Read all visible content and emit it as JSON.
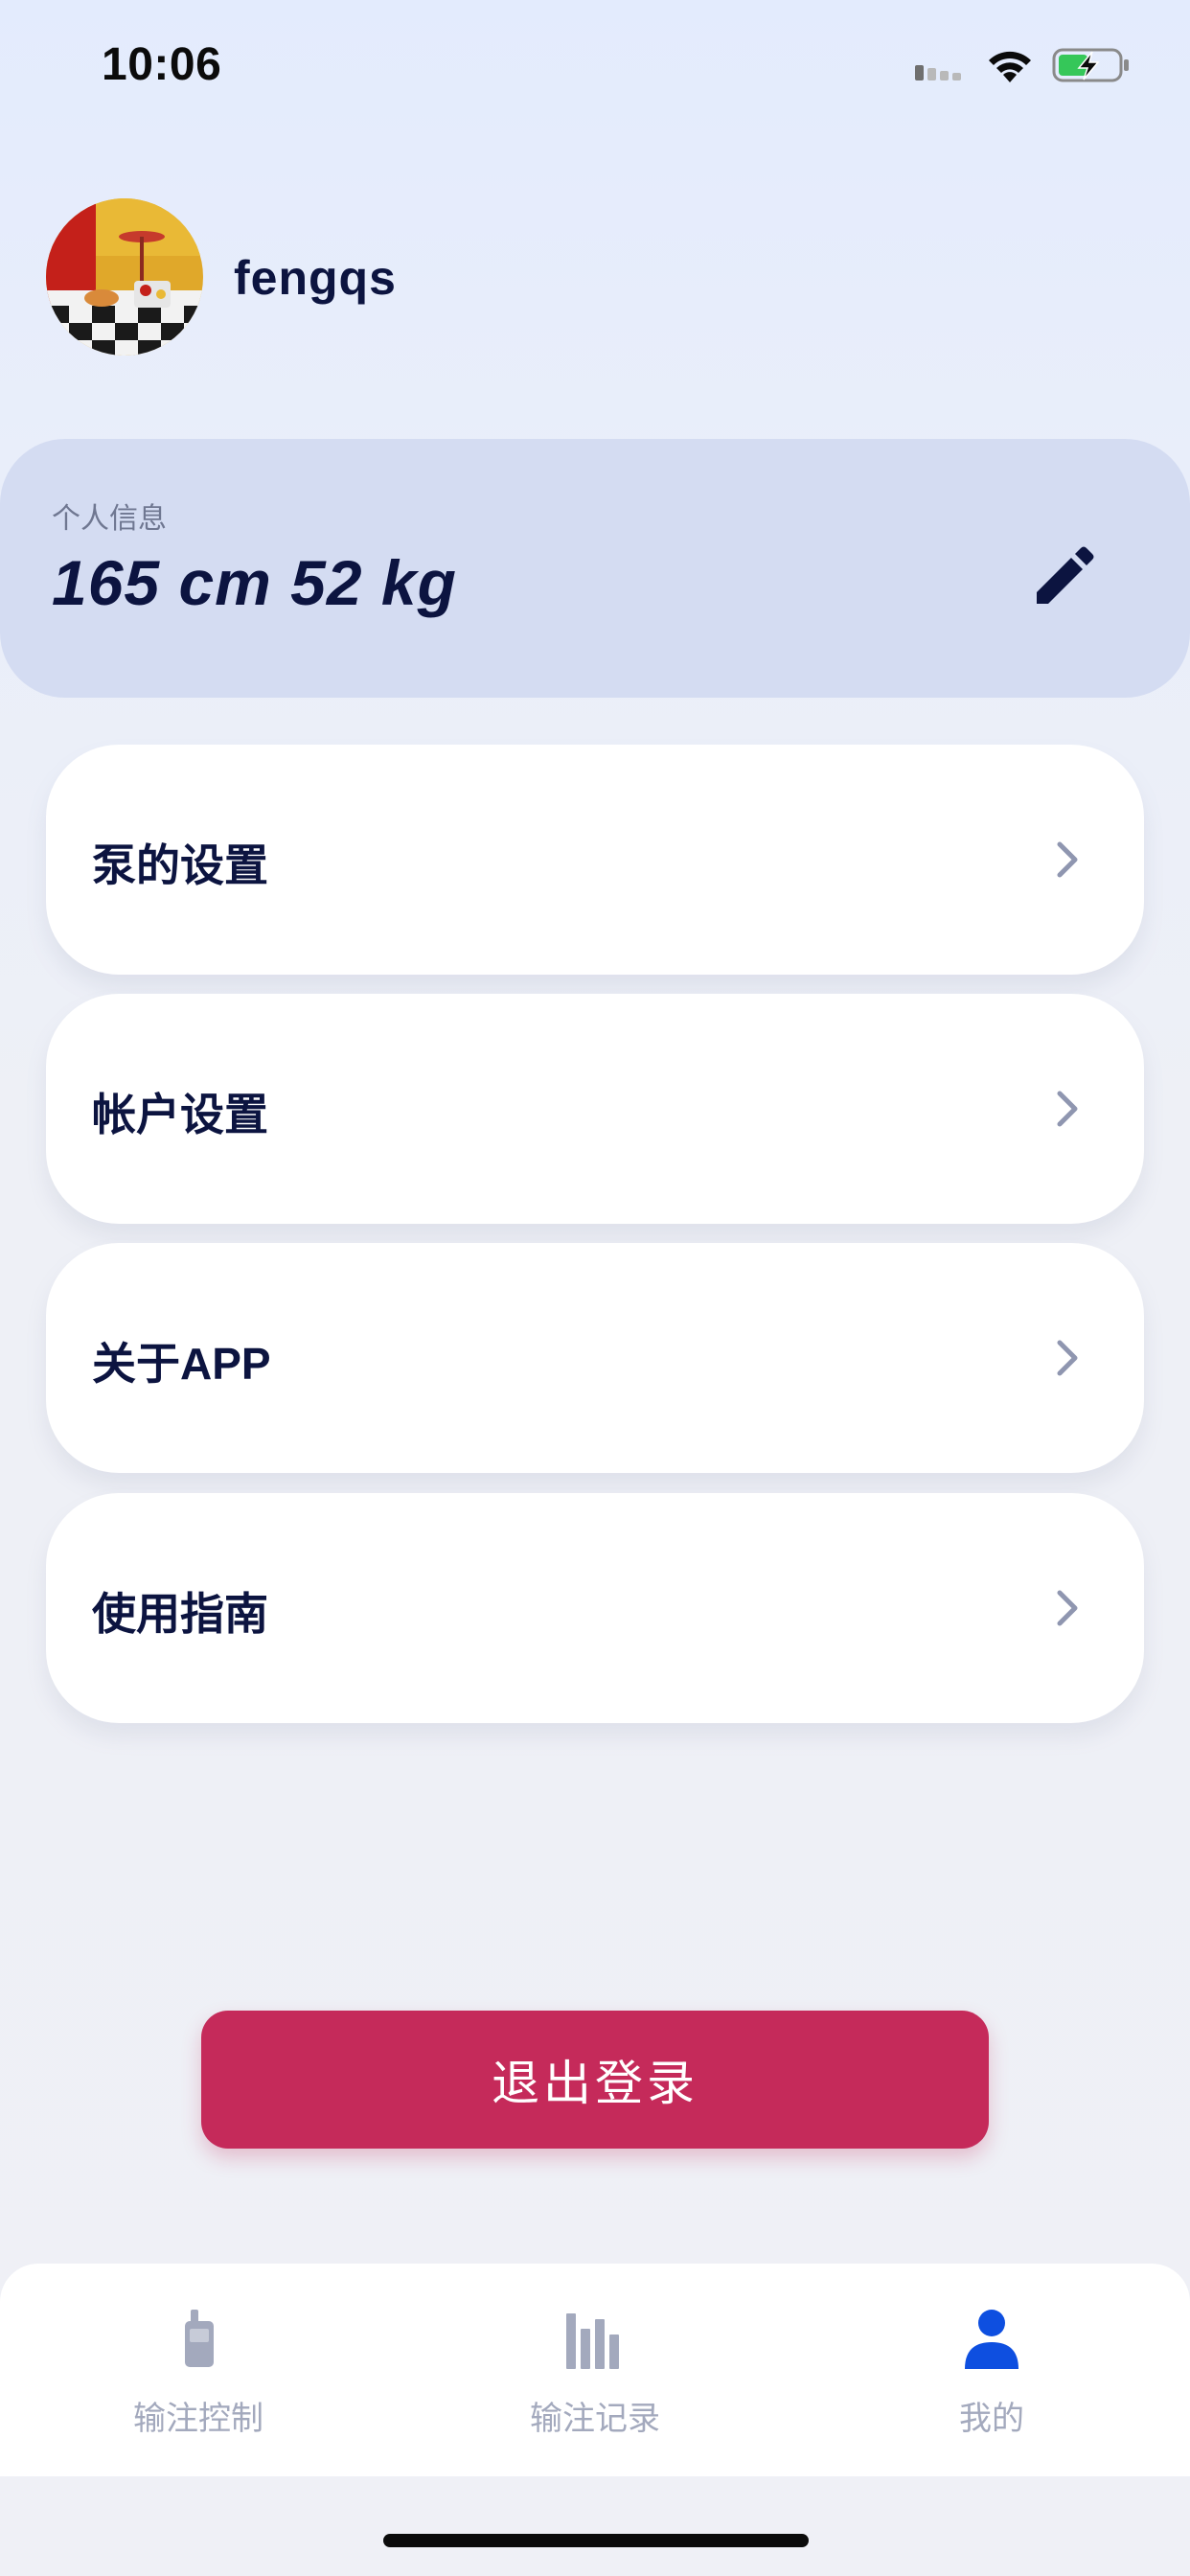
{
  "status_bar": {
    "time": "10:06"
  },
  "profile": {
    "username": "fengqs",
    "avatar_icon": "avatar-photo"
  },
  "personal_info": {
    "label": "个人信息",
    "value": "165 cm 52 kg",
    "edit_icon": "pencil-icon"
  },
  "menu": {
    "items": [
      {
        "label": "泵的设置"
      },
      {
        "label": "帐户设置"
      },
      {
        "label": "关于APP"
      },
      {
        "label": "使用指南"
      }
    ]
  },
  "logout": {
    "label": "退出登录"
  },
  "tabbar": {
    "tabs": [
      {
        "label": "输注控制",
        "icon": "pump-device-icon"
      },
      {
        "label": "输注记录",
        "icon": "bar-chart-icon"
      },
      {
        "label": "我的",
        "icon": "person-icon"
      }
    ]
  },
  "colors": {
    "primary_text": "#0c1440",
    "logout_button": "#c52a5a",
    "active_tab": "#0e4fe0",
    "inactive_tab": "#a3a9bd",
    "info_card": "#d4dcf2"
  }
}
